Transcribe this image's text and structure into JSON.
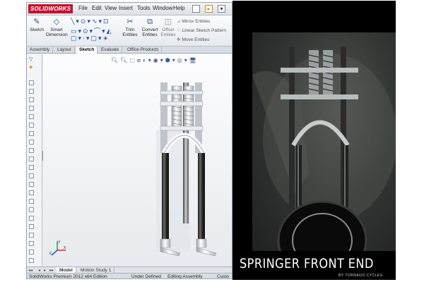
{
  "app": {
    "logo_text": "SOLIDWORKS",
    "menu": [
      "File",
      "Edit",
      "View",
      "Insert",
      "Tools",
      "Window",
      "Help"
    ]
  },
  "ribbon": {
    "sketch": "Sketch",
    "smart_dimension": [
      "Smart",
      "Dimension"
    ],
    "trim_entities": [
      "Trim",
      "Entities"
    ],
    "convert_entities": [
      "Convert",
      "Entities"
    ],
    "offset_entities": [
      "Offset",
      "Entities"
    ],
    "mirror_entities": "Mirror Entities",
    "linear_sketch_pattern": "Linear Sketch Pattern",
    "move_entities": "Move Entities"
  },
  "tabs": [
    {
      "label": "Assembly",
      "active": false
    },
    {
      "label": "Layout",
      "active": false
    },
    {
      "label": "Sketch",
      "active": true
    },
    {
      "label": "Evaluate",
      "active": false
    },
    {
      "label": "Office Products",
      "active": false
    }
  ],
  "bottom_tabs": [
    {
      "label": "Model",
      "active": true
    },
    {
      "label": "Motion Study 1",
      "active": false
    }
  ],
  "status": {
    "edition": "SolidWorks Premium 2012 x64 Edition",
    "definition": "Under Defined",
    "mode": "Editing Assembly",
    "custom": "Custo"
  },
  "photo": {
    "caption": "SPRINGER FRONT END",
    "credit": "BY TORNADO CYCLES"
  },
  "icons": {
    "logo": "solidworks-logo",
    "sketch": "sketch-icon",
    "dimension": "smart-dimension-icon",
    "trim": "trim-icon",
    "convert": "convert-icon",
    "offset": "offset-icon",
    "mirror": "mirror-icon",
    "pattern": "pattern-icon",
    "move": "move-icon",
    "triad": "coordinate-triad-icon"
  },
  "colors": {
    "brand": "#c8102e",
    "accent": "#1f4e9a"
  }
}
